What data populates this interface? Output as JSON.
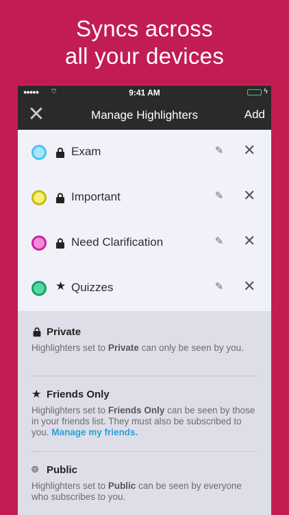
{
  "headline": {
    "line1": "Syncs across",
    "line2": "all your devices"
  },
  "statusbar": {
    "time": "9:41 AM"
  },
  "navbar": {
    "title": "Manage Highlighters",
    "add_label": "Add"
  },
  "highlighters": [
    {
      "label": "Exam",
      "color": "#45c4ef",
      "fill": "#a8e3f7",
      "privacy": "private"
    },
    {
      "label": "Important",
      "color": "#c6bb00",
      "fill": "#f5f07a",
      "privacy": "private"
    },
    {
      "label": "Need Clarification",
      "color": "#d21ea6",
      "fill": "#f28ad9",
      "privacy": "private"
    },
    {
      "label": "Quizzes",
      "color": "#1a9d6a",
      "fill": "#54d9a0",
      "privacy": "friends"
    }
  ],
  "info": {
    "private": {
      "title": "Private",
      "pre": "Highlighters set to ",
      "bold": "Private",
      "post": " can only be seen by you."
    },
    "friends": {
      "title": "Friends Only",
      "pre": "Highlighters set to ",
      "bold": "Friends Only",
      "post": " can be seen by those in your friends list. They must also be subscribed to you. ",
      "link": "Manage my friends."
    },
    "public": {
      "title": "Public",
      "pre": "Highlighters set to ",
      "bold": "Public",
      "post": " can be seen by everyone who subscribes to you."
    }
  }
}
